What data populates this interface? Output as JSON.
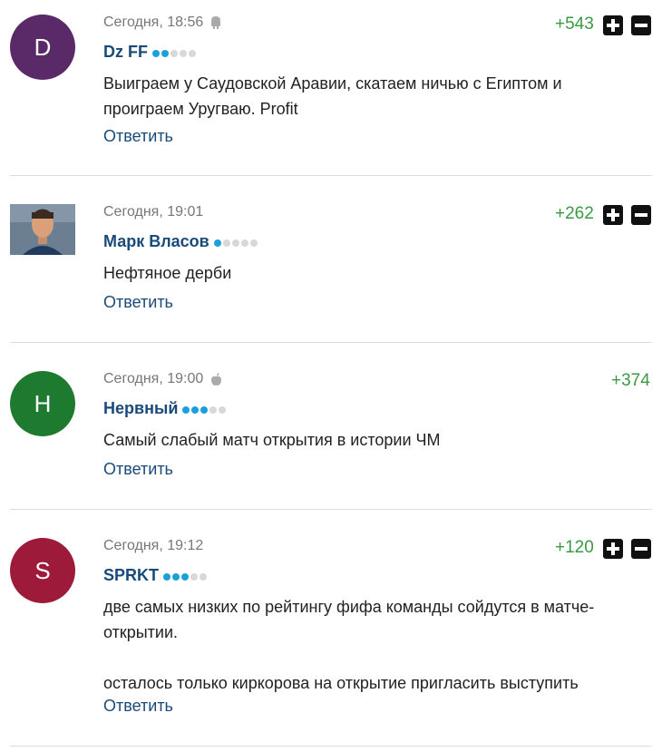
{
  "comments": [
    {
      "avatar_letter": "D",
      "avatar_color": "#5a2a68",
      "time": "Сегодня, 18:56",
      "platform": "android-icon",
      "author": "Dz FF",
      "level": 2,
      "rating": "+543",
      "lines": [
        "Выиграем у Саудовской Аравии, скатаем ничью с Египтом и",
        "проиграем Уругваю. Profit"
      ],
      "reply": "Ответить"
    },
    {
      "avatar_photo": true,
      "time": "Сегодня, 19:01",
      "author": "Марк Власов",
      "level": 1,
      "rating": "+262",
      "lines": [
        "Нефтяное дерби"
      ],
      "reply": "Ответить"
    },
    {
      "avatar_letter": "Н",
      "avatar_color": "#1e7a2e",
      "time": "Сегодня, 19:00",
      "platform": "apple-icon",
      "author": "Нервный",
      "level": 3,
      "rating": "+374",
      "lines": [
        "Самый слабый матч открытия в истории ЧМ"
      ],
      "reply": "Ответить"
    },
    {
      "avatar_letter": "S",
      "avatar_color": "#9e1a3a",
      "time": "Сегодня, 19:12",
      "author": "SPRKT",
      "level": 3,
      "rating": "+120",
      "lines": [
        "две самых низких по рейтингу фифа команды сойдутся в матче-",
        "открытии.",
        "",
        "осталось только киркорова на открытие пригласить выступить"
      ],
      "reply": "Ответить"
    }
  ]
}
